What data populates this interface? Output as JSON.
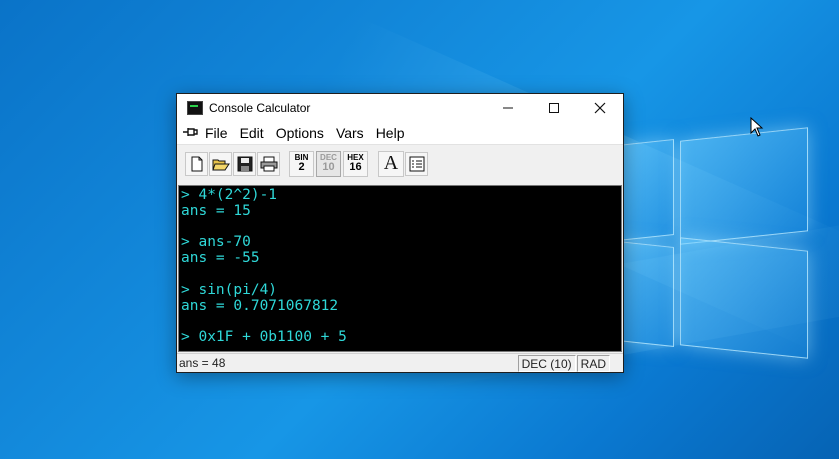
{
  "window": {
    "title": "Console Calculator",
    "minimize_glyph": "—",
    "maximize_glyph": "☐",
    "close_glyph": "✕"
  },
  "menu": {
    "pin_icon": "pin-icon",
    "items": [
      {
        "label": "File"
      },
      {
        "label": "Edit"
      },
      {
        "label": "Options"
      },
      {
        "label": "Vars"
      },
      {
        "label": "Help"
      }
    ]
  },
  "toolbar": {
    "icons": [
      "new-file-icon",
      "open-folder-icon",
      "save-icon",
      "print-icon"
    ],
    "radix": [
      {
        "top": "BIN",
        "bottom": "2",
        "enabled": true
      },
      {
        "top": "DEC",
        "bottom": "10",
        "enabled": false
      },
      {
        "top": "HEX",
        "bottom": "16",
        "enabled": true
      }
    ],
    "font_label": "A",
    "variables_icon": "variables-list-icon"
  },
  "console": {
    "text_color": "#2fd8d8",
    "lines": [
      "> 4*(2^2)-1",
      "ans = 15",
      "",
      "> ans-70",
      "ans = -55",
      "",
      "> sin(pi/4)",
      "ans = 0.7071067812",
      "",
      "> 0x1F + 0b1100 + 5"
    ]
  },
  "status": {
    "message": "ans = 48",
    "radix_mode": "DEC (10)",
    "angle_mode": "RAD"
  }
}
